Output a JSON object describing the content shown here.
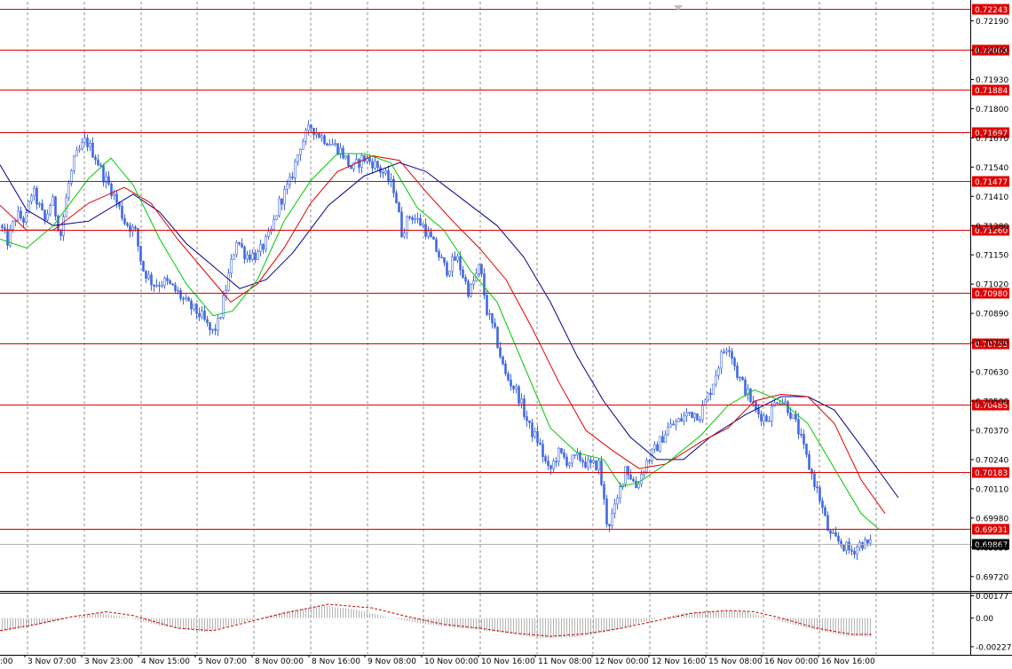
{
  "chart_data": {
    "type": "candlestick",
    "main": {
      "ylim": [
        0.6966,
        0.72275
      ],
      "y_ticks": [
        "0.72190",
        "0.72060",
        "0.71930",
        "0.71800",
        "0.71670",
        "0.71540",
        "0.71410",
        "0.71280",
        "0.71150",
        "0.71020",
        "0.70890",
        "0.70760",
        "0.70630",
        "0.70500",
        "0.70370",
        "0.70240",
        "0.70110",
        "0.69980",
        "0.69850",
        "0.69720"
      ],
      "levels": [
        "0.72243",
        "0.72063",
        "0.71884",
        "0.71697",
        "0.71477",
        "0.71260",
        "0.70980",
        "0.70755",
        "0.70485",
        "0.70183",
        "0.69931"
      ],
      "current_price": "0.69867",
      "anchors": [
        [
          0,
          0.7128
        ],
        [
          8,
          0.7121
        ],
        [
          18,
          0.7133
        ],
        [
          28,
          0.713
        ],
        [
          36,
          0.7144
        ],
        [
          50,
          0.713
        ],
        [
          58,
          0.714
        ],
        [
          68,
          0.7124
        ],
        [
          76,
          0.7145
        ],
        [
          84,
          0.7158
        ],
        [
          96,
          0.7166
        ],
        [
          108,
          0.7158
        ],
        [
          116,
          0.715
        ],
        [
          125,
          0.7144
        ],
        [
          140,
          0.713
        ],
        [
          152,
          0.7125
        ],
        [
          160,
          0.7109
        ],
        [
          172,
          0.7102
        ],
        [
          186,
          0.7103
        ],
        [
          200,
          0.7098
        ],
        [
          210,
          0.7093
        ],
        [
          226,
          0.7088
        ],
        [
          238,
          0.708
        ],
        [
          246,
          0.7085
        ],
        [
          256,
          0.7104
        ],
        [
          266,
          0.7122
        ],
        [
          276,
          0.7115
        ],
        [
          290,
          0.7115
        ],
        [
          304,
          0.7124
        ],
        [
          314,
          0.7138
        ],
        [
          326,
          0.7147
        ],
        [
          338,
          0.7164
        ],
        [
          350,
          0.7172
        ],
        [
          360,
          0.7168
        ],
        [
          372,
          0.7165
        ],
        [
          384,
          0.7161
        ],
        [
          396,
          0.7153
        ],
        [
          408,
          0.7158
        ],
        [
          420,
          0.7156
        ],
        [
          432,
          0.7151
        ],
        [
          444,
          0.7144
        ],
        [
          452,
          0.7125
        ],
        [
          462,
          0.7133
        ],
        [
          476,
          0.7128
        ],
        [
          490,
          0.7118
        ],
        [
          502,
          0.7108
        ],
        [
          514,
          0.7114
        ],
        [
          528,
          0.7098
        ],
        [
          540,
          0.711
        ],
        [
          548,
          0.709
        ],
        [
          558,
          0.7079
        ],
        [
          568,
          0.7062
        ],
        [
          582,
          0.7054
        ],
        [
          596,
          0.7038
        ],
        [
          606,
          0.7032
        ],
        [
          618,
          0.7018
        ],
        [
          628,
          0.7027
        ],
        [
          640,
          0.7023
        ],
        [
          652,
          0.7025
        ],
        [
          664,
          0.7021
        ],
        [
          674,
          0.7022
        ],
        [
          684,
          0.6994
        ],
        [
          694,
          0.7004
        ],
        [
          704,
          0.7021
        ],
        [
          716,
          0.7012
        ],
        [
          728,
          0.7023
        ],
        [
          740,
          0.703
        ],
        [
          752,
          0.7038
        ],
        [
          764,
          0.7041
        ],
        [
          776,
          0.7045
        ],
        [
          788,
          0.7044
        ],
        [
          800,
          0.7055
        ],
        [
          812,
          0.707
        ],
        [
          820,
          0.7076
        ],
        [
          830,
          0.7062
        ],
        [
          842,
          0.7053
        ],
        [
          852,
          0.7045
        ],
        [
          864,
          0.7042
        ],
        [
          876,
          0.7052
        ],
        [
          886,
          0.7048
        ],
        [
          898,
          0.7038
        ],
        [
          910,
          0.7022
        ],
        [
          922,
          0.7008
        ],
        [
          934,
          0.699
        ],
        [
          946,
          0.6987
        ],
        [
          958,
          0.6983
        ],
        [
          970,
          0.6987
        ],
        [
          980,
          0.6986
        ]
      ],
      "ma_fast": [
        [
          0,
          0.7122
        ],
        [
          30,
          0.7118
        ],
        [
          60,
          0.7128
        ],
        [
          100,
          0.7149
        ],
        [
          125,
          0.7158
        ],
        [
          150,
          0.7146
        ],
        [
          180,
          0.7122
        ],
        [
          210,
          0.7102
        ],
        [
          240,
          0.7088
        ],
        [
          262,
          0.709
        ],
        [
          290,
          0.7104
        ],
        [
          320,
          0.713
        ],
        [
          350,
          0.7148
        ],
        [
          380,
          0.716
        ],
        [
          410,
          0.716
        ],
        [
          440,
          0.7156
        ],
        [
          470,
          0.7136
        ],
        [
          500,
          0.7126
        ],
        [
          530,
          0.7108
        ],
        [
          560,
          0.7094
        ],
        [
          590,
          0.7066
        ],
        [
          620,
          0.7038
        ],
        [
          650,
          0.7027
        ],
        [
          680,
          0.7024
        ],
        [
          700,
          0.7012
        ],
        [
          720,
          0.7014
        ],
        [
          750,
          0.7022
        ],
        [
          790,
          0.7035
        ],
        [
          820,
          0.7048
        ],
        [
          850,
          0.7055
        ],
        [
          880,
          0.705
        ],
        [
          910,
          0.704
        ],
        [
          940,
          0.702
        ],
        [
          970,
          0.7
        ],
        [
          990,
          0.6993
        ]
      ],
      "ma_mid": [
        [
          0,
          0.7137
        ],
        [
          30,
          0.7126
        ],
        [
          60,
          0.7126
        ],
        [
          100,
          0.7138
        ],
        [
          140,
          0.7145
        ],
        [
          170,
          0.7138
        ],
        [
          200,
          0.7122
        ],
        [
          230,
          0.7108
        ],
        [
          260,
          0.7094
        ],
        [
          290,
          0.7102
        ],
        [
          320,
          0.7118
        ],
        [
          350,
          0.7138
        ],
        [
          380,
          0.7152
        ],
        [
          420,
          0.7159
        ],
        [
          450,
          0.7157
        ],
        [
          480,
          0.7143
        ],
        [
          510,
          0.713
        ],
        [
          540,
          0.7118
        ],
        [
          570,
          0.7104
        ],
        [
          600,
          0.7082
        ],
        [
          630,
          0.7058
        ],
        [
          660,
          0.7037
        ],
        [
          690,
          0.7028
        ],
        [
          720,
          0.702
        ],
        [
          750,
          0.7022
        ],
        [
          790,
          0.7032
        ],
        [
          820,
          0.7038
        ],
        [
          850,
          0.705
        ],
        [
          880,
          0.7053
        ],
        [
          910,
          0.7052
        ],
        [
          940,
          0.704
        ],
        [
          970,
          0.7015
        ],
        [
          997,
          0.7
        ]
      ],
      "ma_slow": [
        [
          0,
          0.7155
        ],
        [
          30,
          0.7135
        ],
        [
          60,
          0.7128
        ],
        [
          100,
          0.713
        ],
        [
          150,
          0.7142
        ],
        [
          180,
          0.7134
        ],
        [
          210,
          0.712
        ],
        [
          240,
          0.711
        ],
        [
          270,
          0.71
        ],
        [
          300,
          0.7104
        ],
        [
          330,
          0.7116
        ],
        [
          370,
          0.7137
        ],
        [
          410,
          0.715
        ],
        [
          450,
          0.7156
        ],
        [
          480,
          0.7152
        ],
        [
          520,
          0.714
        ],
        [
          560,
          0.7128
        ],
        [
          590,
          0.7114
        ],
        [
          620,
          0.7094
        ],
        [
          650,
          0.707
        ],
        [
          680,
          0.705
        ],
        [
          710,
          0.7034
        ],
        [
          740,
          0.7024
        ],
        [
          770,
          0.7024
        ],
        [
          800,
          0.7034
        ],
        [
          840,
          0.7044
        ],
        [
          880,
          0.7052
        ],
        [
          910,
          0.7052
        ],
        [
          940,
          0.7046
        ],
        [
          970,
          0.703
        ],
        [
          1012,
          0.7007
        ]
      ]
    },
    "sub": {
      "ylim": [
        -0.00285,
        0.00195
      ],
      "y_ticks": [
        "0.00177",
        "0.00",
        "-0.002277"
      ],
      "signal": [
        [
          0,
          -0.001
        ],
        [
          40,
          -0.0005
        ],
        [
          80,
          0.0001
        ],
        [
          120,
          0.0005
        ],
        [
          150,
          0.0002
        ],
        [
          200,
          -0.0008
        ],
        [
          240,
          -0.001
        ],
        [
          280,
          -0.0003
        ],
        [
          320,
          0.0004
        ],
        [
          370,
          0.0011
        ],
        [
          420,
          0.0008
        ],
        [
          460,
          0.0001
        ],
        [
          500,
          -0.0005
        ],
        [
          540,
          -0.0008
        ],
        [
          580,
          -0.0012
        ],
        [
          620,
          -0.00145
        ],
        [
          660,
          -0.00125
        ],
        [
          700,
          -0.0008
        ],
        [
          740,
          -0.0002
        ],
        [
          780,
          0.0004
        ],
        [
          820,
          0.0006
        ],
        [
          850,
          0.0005
        ],
        [
          880,
          0.0
        ],
        [
          920,
          -0.0008
        ],
        [
          960,
          -0.0013
        ],
        [
          982,
          -0.0013
        ]
      ],
      "hist": [
        [
          0,
          -0.0011
        ],
        [
          40,
          -0.0006
        ],
        [
          80,
          0.0
        ],
        [
          110,
          0.0004
        ],
        [
          140,
          0.0001
        ],
        [
          180,
          -0.0006
        ],
        [
          230,
          -0.0011
        ],
        [
          270,
          -0.0004
        ],
        [
          320,
          0.0005
        ],
        [
          360,
          0.001
        ],
        [
          400,
          0.0007
        ],
        [
          440,
          0.0
        ],
        [
          480,
          -0.0005
        ],
        [
          520,
          -0.0008
        ],
        [
          560,
          -0.0011
        ],
        [
          610,
          -0.0016
        ],
        [
          650,
          -0.0015
        ],
        [
          690,
          -0.001
        ],
        [
          730,
          -0.0002
        ],
        [
          770,
          0.0004
        ],
        [
          810,
          0.0006
        ],
        [
          840,
          0.0005
        ],
        [
          870,
          -0.0001
        ],
        [
          910,
          -0.0008
        ],
        [
          950,
          -0.0014
        ],
        [
          982,
          -0.0015
        ]
      ]
    },
    "x_ticks": [
      "3 Nov 07:00",
      "3 Nov 23:00",
      "4 Nov 15:00",
      "5 Nov 07:00",
      "8 Nov 00:00",
      "8 Nov 16:00",
      "9 Nov 08:00",
      "10 Nov 00:00",
      "10 Nov 16:00",
      "11 Nov 08:00",
      "12 Nov 00:00",
      "12 Nov 16:00",
      "15 Nov 08:00",
      "16 Nov 00:00",
      "16 Nov 16:00"
    ],
    "x_tick_first": ":00",
    "colors": {
      "up": "#4169e1",
      "down": "#4169e1",
      "level": "#e00000",
      "ma_fast": "#00c800",
      "ma_mid": "#e00000",
      "ma_slow": "#00008b",
      "grid": "#8c8c8c",
      "hist": "#b4b4b4",
      "signal": "#c80000",
      "current_bg": "#000000"
    }
  }
}
